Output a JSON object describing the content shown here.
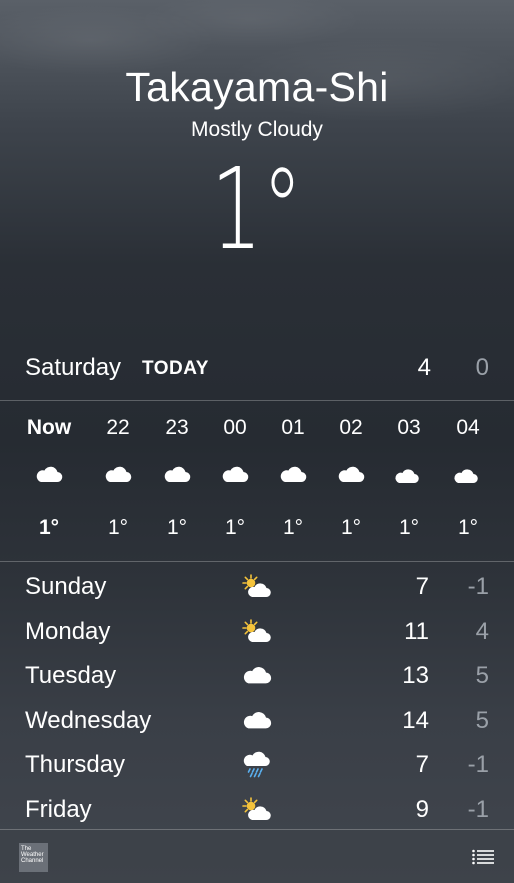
{
  "location": {
    "city": "Takayama-Shi",
    "condition": "Mostly Cloudy",
    "current_temp": "1°"
  },
  "today": {
    "day": "Saturday",
    "tag": "TODAY",
    "high": "4",
    "low": "0"
  },
  "hourly": [
    {
      "hour": "Now",
      "icon": "cloud-icon",
      "temp": "1°"
    },
    {
      "hour": "22",
      "icon": "cloud-icon",
      "temp": "1°"
    },
    {
      "hour": "23",
      "icon": "cloud-icon",
      "temp": "1°"
    },
    {
      "hour": "00",
      "icon": "cloud-icon",
      "temp": "1°"
    },
    {
      "hour": "01",
      "icon": "cloud-icon",
      "temp": "1°"
    },
    {
      "hour": "02",
      "icon": "cloud-icon",
      "temp": "1°"
    },
    {
      "hour": "03",
      "icon": "partly-cloudy-night-icon",
      "temp": "1°"
    },
    {
      "hour": "04",
      "icon": "partly-cloudy-night-icon",
      "temp": "1°"
    }
  ],
  "daily": [
    {
      "day": "Sunday",
      "icon": "partly-sunny-icon",
      "high": "7",
      "low": "-1"
    },
    {
      "day": "Monday",
      "icon": "partly-sunny-icon",
      "high": "11",
      "low": "4"
    },
    {
      "day": "Tuesday",
      "icon": "cloud-icon",
      "high": "13",
      "low": "5"
    },
    {
      "day": "Wednesday",
      "icon": "cloud-icon",
      "high": "14",
      "low": "5"
    },
    {
      "day": "Thursday",
      "icon": "rain-icon",
      "high": "7",
      "low": "-1"
    },
    {
      "day": "Friday",
      "icon": "partly-sunny-icon",
      "high": "9",
      "low": "-1"
    }
  ],
  "footer": {
    "logo_text": "The Weather Channel",
    "list_icon": "list-icon"
  },
  "colors": {
    "text": "#ffffff",
    "muted": "#9aa0a8",
    "sun": "#f5c33b"
  }
}
